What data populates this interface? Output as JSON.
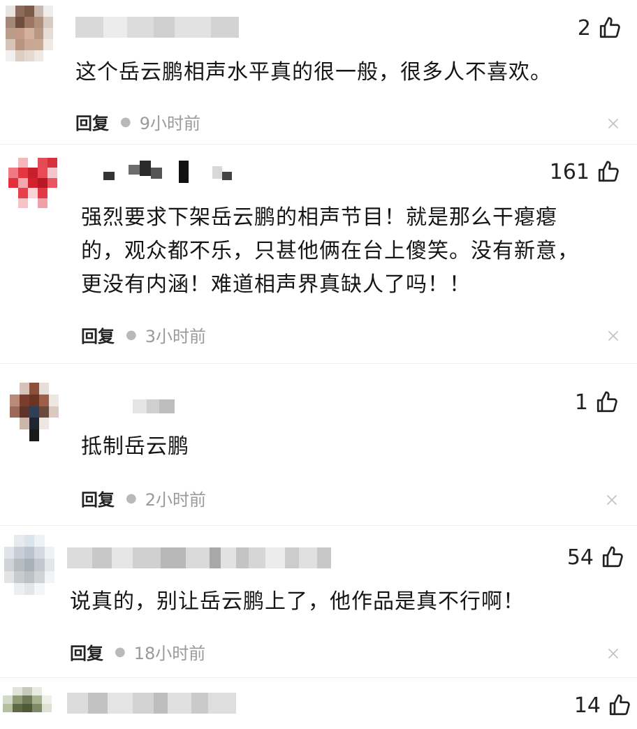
{
  "comments": [
    {
      "text": "这个岳云鹏相声水平真的很一般，很多人不喜欢。",
      "likes": "2",
      "reply_label": "回复",
      "time": "9小时前"
    },
    {
      "text": "强烈要求下架岳云鹏的相声节目！就是那么干瘪瘪\n的，观众都不乐，只甚他俩在台上傻笑。没有新意，\n更没有内涵！难道相声界真缺人了吗！！",
      "likes": "161",
      "reply_label": "回复",
      "time": "3小时前"
    },
    {
      "text": "抵制岳云鹏",
      "likes": "1",
      "reply_label": "回复",
      "time": "2小时前"
    },
    {
      "text": "说真的，别让岳云鹏上了，他作品是真不行啊！",
      "likes": "54",
      "reply_label": "回复",
      "time": "18小时前"
    },
    {
      "likes": "14"
    }
  ],
  "icons": {
    "like": "thumbs-up-icon",
    "close": "close-icon"
  },
  "colors": {
    "text": "#161616",
    "meta": "#9a9a9a",
    "reply": "#222222"
  }
}
